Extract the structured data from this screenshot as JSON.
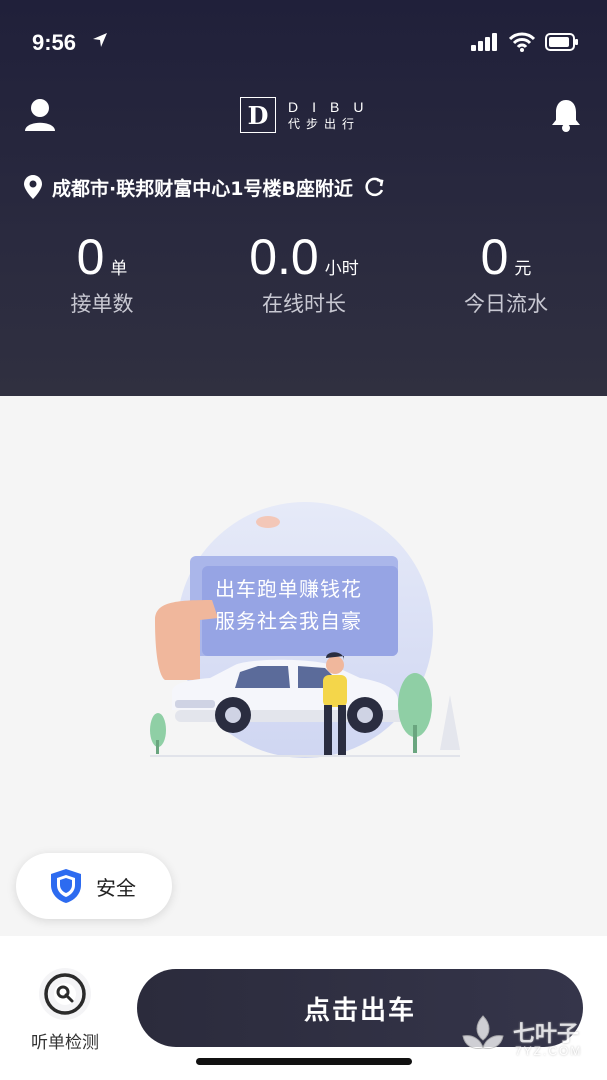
{
  "status_bar": {
    "time": "9:56"
  },
  "header": {
    "logo": {
      "letter": "D",
      "en": "DIBU",
      "cn": "代步出行"
    },
    "location": "成都市·联邦财富中心1号楼B座附近"
  },
  "stats": [
    {
      "value": "0",
      "unit": "单",
      "label": "接单数"
    },
    {
      "value": "0.0",
      "unit": "小时",
      "label": "在线时长"
    },
    {
      "value": "0",
      "unit": "元",
      "label": "今日流水"
    }
  ],
  "illustration": {
    "line1": "出车跑单赚钱花",
    "line2": "服务社会我自豪"
  },
  "safety": {
    "label": "安全"
  },
  "bottom": {
    "listen_label": "听单检测",
    "start_label": "点击出车"
  },
  "watermark": {
    "text": "七叶子",
    "sub": "7YZ.COM"
  },
  "colors": {
    "header_bg": "#20203a",
    "button_bg": "#2b2b3c",
    "shield": "#2d6bf0"
  }
}
